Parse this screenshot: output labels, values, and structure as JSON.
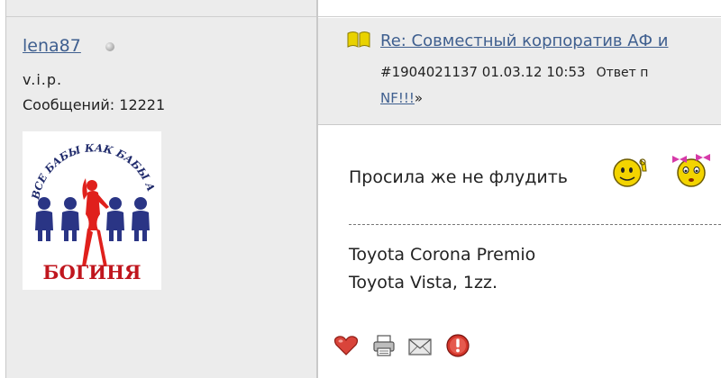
{
  "user": {
    "name": "lena87",
    "rank": "v.i.p.",
    "posts_label": "Сообщений: 12221",
    "online_status": "offline",
    "avatar": {
      "arc_text": "ВСЕ БАБЫ КАК БАБЫ А Я",
      "caption": "БОГИНЯ"
    }
  },
  "post": {
    "title": "Re: Совместный корпоратив АФ и",
    "meta_id_date": "#1904021137 01.03.12 10:53",
    "meta_reply": "Ответ п",
    "ref_link": "NF!!!",
    "ref_suffix": "»",
    "message": "Просила же не флудить",
    "signature": [
      "Toyota Corona Premio",
      "Toyota Vista, 1zz."
    ]
  },
  "icons": {
    "title": "open-book-icon",
    "status": "status-dot-icon",
    "smiley1": "smiley-ok-icon",
    "smiley2": "smiley-girl-icon",
    "actions": [
      "heart-icon",
      "print-icon",
      "envelope-icon",
      "warning-icon"
    ]
  },
  "colors": {
    "link": "#3f5f8f",
    "sidebar_bg": "#ececec",
    "heart": "#d9443a",
    "warning": "#d2352a"
  }
}
